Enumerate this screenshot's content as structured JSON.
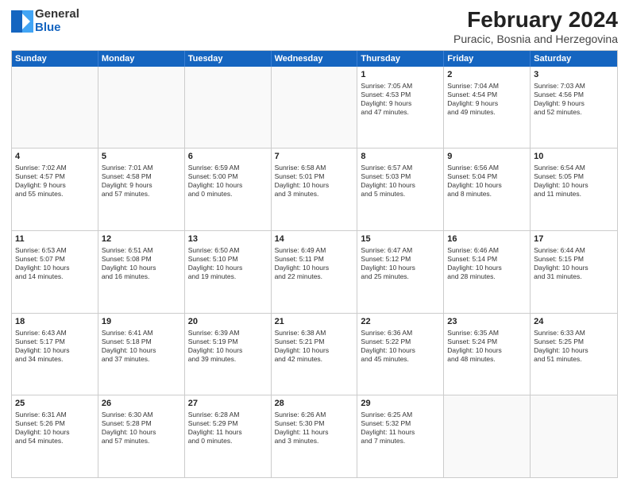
{
  "logo": {
    "general": "General",
    "blue": "Blue"
  },
  "title": "February 2024",
  "subtitle": "Puracic, Bosnia and Herzegovina",
  "days": [
    "Sunday",
    "Monday",
    "Tuesday",
    "Wednesday",
    "Thursday",
    "Friday",
    "Saturday"
  ],
  "weeks": [
    [
      {
        "day": "",
        "text": ""
      },
      {
        "day": "",
        "text": ""
      },
      {
        "day": "",
        "text": ""
      },
      {
        "day": "",
        "text": ""
      },
      {
        "day": "1",
        "text": "Sunrise: 7:05 AM\nSunset: 4:53 PM\nDaylight: 9 hours\nand 47 minutes."
      },
      {
        "day": "2",
        "text": "Sunrise: 7:04 AM\nSunset: 4:54 PM\nDaylight: 9 hours\nand 49 minutes."
      },
      {
        "day": "3",
        "text": "Sunrise: 7:03 AM\nSunset: 4:56 PM\nDaylight: 9 hours\nand 52 minutes."
      }
    ],
    [
      {
        "day": "4",
        "text": "Sunrise: 7:02 AM\nSunset: 4:57 PM\nDaylight: 9 hours\nand 55 minutes."
      },
      {
        "day": "5",
        "text": "Sunrise: 7:01 AM\nSunset: 4:58 PM\nDaylight: 9 hours\nand 57 minutes."
      },
      {
        "day": "6",
        "text": "Sunrise: 6:59 AM\nSunset: 5:00 PM\nDaylight: 10 hours\nand 0 minutes."
      },
      {
        "day": "7",
        "text": "Sunrise: 6:58 AM\nSunset: 5:01 PM\nDaylight: 10 hours\nand 3 minutes."
      },
      {
        "day": "8",
        "text": "Sunrise: 6:57 AM\nSunset: 5:03 PM\nDaylight: 10 hours\nand 5 minutes."
      },
      {
        "day": "9",
        "text": "Sunrise: 6:56 AM\nSunset: 5:04 PM\nDaylight: 10 hours\nand 8 minutes."
      },
      {
        "day": "10",
        "text": "Sunrise: 6:54 AM\nSunset: 5:05 PM\nDaylight: 10 hours\nand 11 minutes."
      }
    ],
    [
      {
        "day": "11",
        "text": "Sunrise: 6:53 AM\nSunset: 5:07 PM\nDaylight: 10 hours\nand 14 minutes."
      },
      {
        "day": "12",
        "text": "Sunrise: 6:51 AM\nSunset: 5:08 PM\nDaylight: 10 hours\nand 16 minutes."
      },
      {
        "day": "13",
        "text": "Sunrise: 6:50 AM\nSunset: 5:10 PM\nDaylight: 10 hours\nand 19 minutes."
      },
      {
        "day": "14",
        "text": "Sunrise: 6:49 AM\nSunset: 5:11 PM\nDaylight: 10 hours\nand 22 minutes."
      },
      {
        "day": "15",
        "text": "Sunrise: 6:47 AM\nSunset: 5:12 PM\nDaylight: 10 hours\nand 25 minutes."
      },
      {
        "day": "16",
        "text": "Sunrise: 6:46 AM\nSunset: 5:14 PM\nDaylight: 10 hours\nand 28 minutes."
      },
      {
        "day": "17",
        "text": "Sunrise: 6:44 AM\nSunset: 5:15 PM\nDaylight: 10 hours\nand 31 minutes."
      }
    ],
    [
      {
        "day": "18",
        "text": "Sunrise: 6:43 AM\nSunset: 5:17 PM\nDaylight: 10 hours\nand 34 minutes."
      },
      {
        "day": "19",
        "text": "Sunrise: 6:41 AM\nSunset: 5:18 PM\nDaylight: 10 hours\nand 37 minutes."
      },
      {
        "day": "20",
        "text": "Sunrise: 6:39 AM\nSunset: 5:19 PM\nDaylight: 10 hours\nand 39 minutes."
      },
      {
        "day": "21",
        "text": "Sunrise: 6:38 AM\nSunset: 5:21 PM\nDaylight: 10 hours\nand 42 minutes."
      },
      {
        "day": "22",
        "text": "Sunrise: 6:36 AM\nSunset: 5:22 PM\nDaylight: 10 hours\nand 45 minutes."
      },
      {
        "day": "23",
        "text": "Sunrise: 6:35 AM\nSunset: 5:24 PM\nDaylight: 10 hours\nand 48 minutes."
      },
      {
        "day": "24",
        "text": "Sunrise: 6:33 AM\nSunset: 5:25 PM\nDaylight: 10 hours\nand 51 minutes."
      }
    ],
    [
      {
        "day": "25",
        "text": "Sunrise: 6:31 AM\nSunset: 5:26 PM\nDaylight: 10 hours\nand 54 minutes."
      },
      {
        "day": "26",
        "text": "Sunrise: 6:30 AM\nSunset: 5:28 PM\nDaylight: 10 hours\nand 57 minutes."
      },
      {
        "day": "27",
        "text": "Sunrise: 6:28 AM\nSunset: 5:29 PM\nDaylight: 11 hours\nand 0 minutes."
      },
      {
        "day": "28",
        "text": "Sunrise: 6:26 AM\nSunset: 5:30 PM\nDaylight: 11 hours\nand 3 minutes."
      },
      {
        "day": "29",
        "text": "Sunrise: 6:25 AM\nSunset: 5:32 PM\nDaylight: 11 hours\nand 7 minutes."
      },
      {
        "day": "",
        "text": ""
      },
      {
        "day": "",
        "text": ""
      }
    ]
  ]
}
